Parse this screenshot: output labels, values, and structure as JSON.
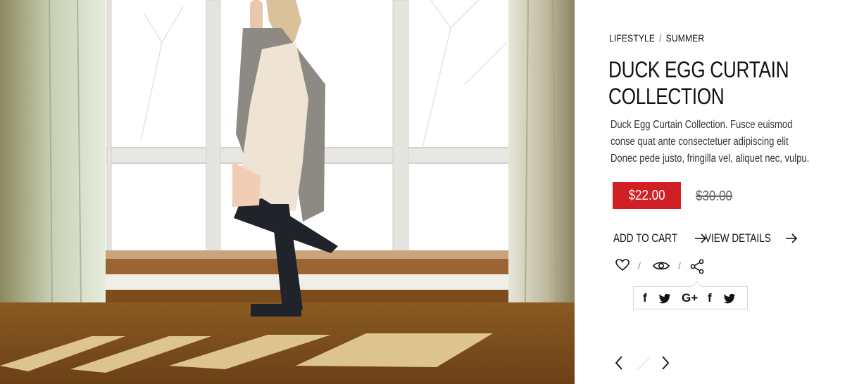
{
  "breadcrumb": {
    "items": [
      "LIFESTYLE",
      "SUMMER"
    ],
    "separator": "/"
  },
  "product": {
    "title": "DUCK EGG CURTAIN COLLECTION",
    "description": "Duck Egg Curtain Collection. Fusce euismod conse quat ante consectetuer adipiscing elit Donec pede justo, fringilla vel, aliquet nec, vulpu.",
    "price": "$22.00",
    "old_price": "$30.00"
  },
  "actions": {
    "add_to_cart": "ADD TO CART",
    "view_details": "VIEW DETAILS"
  },
  "icon_row": {
    "separator": "/",
    "icons": [
      "heart-icon",
      "eye-icon",
      "share-icon"
    ]
  },
  "share_menu": {
    "icons": [
      "facebook-icon",
      "twitter-icon",
      "google-plus-icon",
      "facebook-icon",
      "twitter-icon"
    ],
    "glyphs": [
      "f",
      "G+",
      "f"
    ]
  },
  "pager": {
    "icons": [
      "chevron-left-icon",
      "chevron-right-icon"
    ]
  },
  "colors": {
    "accent": "#d11f26",
    "text": "#111111",
    "muted": "#666666",
    "border": "#d8d8d8"
  },
  "hero_image": {
    "icon": "product-photo"
  }
}
